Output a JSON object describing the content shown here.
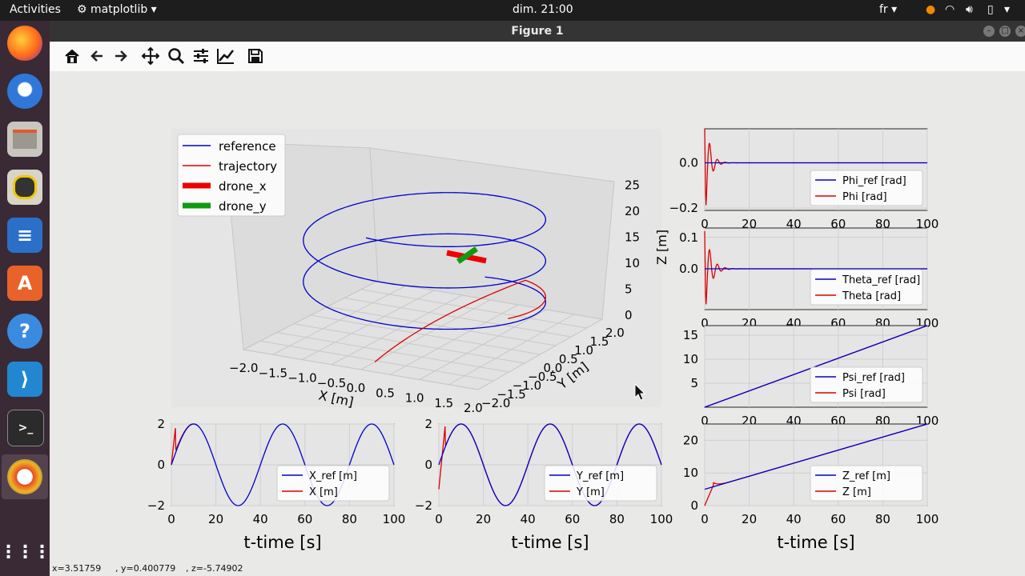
{
  "topbar": {
    "activities": "Activities",
    "app_menu": "matplotlib",
    "clock": "dim. 21:00",
    "lang": "fr"
  },
  "window": {
    "title": "Figure 1"
  },
  "dock": [
    {
      "name": "firefox"
    },
    {
      "name": "thunderbird"
    },
    {
      "name": "files"
    },
    {
      "name": "rhythmbox"
    },
    {
      "name": "writer"
    },
    {
      "name": "software"
    },
    {
      "name": "help"
    },
    {
      "name": "vscode"
    },
    {
      "name": "terminal"
    },
    {
      "name": "matplotlib"
    }
  ],
  "toolbar": [
    "home-icon",
    "back-icon",
    "forward-icon",
    "pan-icon",
    "zoom-icon",
    "configure-subplots-icon",
    "edit-axes-icon",
    "save-icon"
  ],
  "status": {
    "x": "x=3.51759",
    "y": ", y=0.400779",
    "z": ", z=-5.74902"
  },
  "legend3d": [
    "reference",
    "trajectory",
    "drone_x",
    "drone_y"
  ],
  "colors": {
    "reference": "#0000cc",
    "trajectory": "#dd0000",
    "drone_x": "#ee0000",
    "drone_y": "#119911"
  },
  "axes3d": {
    "xticks": [
      "−2.0",
      "−1.5",
      "−1.0",
      "−0.5",
      "0.0",
      "0.5",
      "1.0",
      "1.5",
      "2.0"
    ],
    "yticks": [
      "−2.0",
      "−1.5",
      "−1.0",
      "−0.5",
      "0.0",
      "0.5",
      "1.0",
      "1.5",
      "2.0"
    ],
    "zticks": [
      "0",
      "5",
      "10",
      "15",
      "20",
      "25"
    ],
    "xlabel": "X [m]",
    "ylabel": "Y [m]",
    "zlabel": "Z [m]"
  },
  "chart_data": [
    {
      "id": "phi",
      "type": "line",
      "ylim": [
        -0.21,
        0.15
      ],
      "yticks": [
        "0.0",
        "−0.2"
      ],
      "ytick_values": [
        0,
        -0.2
      ],
      "xticks": [
        "0",
        "20",
        "40",
        "60",
        "80",
        "100"
      ],
      "series": [
        {
          "name": "Phi_ref [rad]"
        },
        {
          "name": "Phi [rad]"
        }
      ]
    },
    {
      "id": "theta",
      "type": "line",
      "ylim": [
        -0.13,
        0.13
      ],
      "yticks": [
        "0.1",
        "0.0"
      ],
      "ytick_values": [
        0.1,
        0
      ],
      "xticks": [
        "0",
        "20",
        "40",
        "60",
        "80",
        "100"
      ],
      "series": [
        {
          "name": "Theta_ref [rad]"
        },
        {
          "name": "Theta [rad]"
        }
      ]
    },
    {
      "id": "psi",
      "type": "line",
      "ylim": [
        0,
        17
      ],
      "yticks": [
        "15",
        "10",
        "5"
      ],
      "ytick_values": [
        15,
        10,
        5
      ],
      "xticks": [
        "0",
        "20",
        "40",
        "60",
        "80",
        "100"
      ],
      "series": [
        {
          "name": "Psi_ref [rad]"
        },
        {
          "name": "Psi [rad]"
        }
      ]
    },
    {
      "id": "x",
      "type": "line",
      "ylim": [
        -2,
        2
      ],
      "yticks": [
        "2",
        "0",
        "−2"
      ],
      "ytick_values": [
        2,
        0,
        -2
      ],
      "xticks": [
        "0",
        "20",
        "40",
        "60",
        "80",
        "100"
      ],
      "xlabel": "t-time [s]",
      "series": [
        {
          "name": "X_ref [m]"
        },
        {
          "name": "X [m]"
        }
      ]
    },
    {
      "id": "y",
      "type": "line",
      "ylim": [
        -2,
        2
      ],
      "yticks": [
        "2",
        "0",
        "−2"
      ],
      "ytick_values": [
        2,
        0,
        -2
      ],
      "xticks": [
        "0",
        "20",
        "40",
        "60",
        "80",
        "100"
      ],
      "xlabel": "t-time [s]",
      "series": [
        {
          "name": "Y_ref [m]"
        },
        {
          "name": "Y [m]"
        }
      ]
    },
    {
      "id": "z",
      "type": "line",
      "ylim": [
        0,
        25
      ],
      "yticks": [
        "20",
        "10",
        "0"
      ],
      "ytick_values": [
        20,
        10,
        0
      ],
      "xticks": [
        "0",
        "20",
        "40",
        "60",
        "80",
        "100"
      ],
      "xlabel": "t-time [s]",
      "series": [
        {
          "name": "Z_ref [m]"
        },
        {
          "name": "Z [m]"
        }
      ]
    }
  ]
}
